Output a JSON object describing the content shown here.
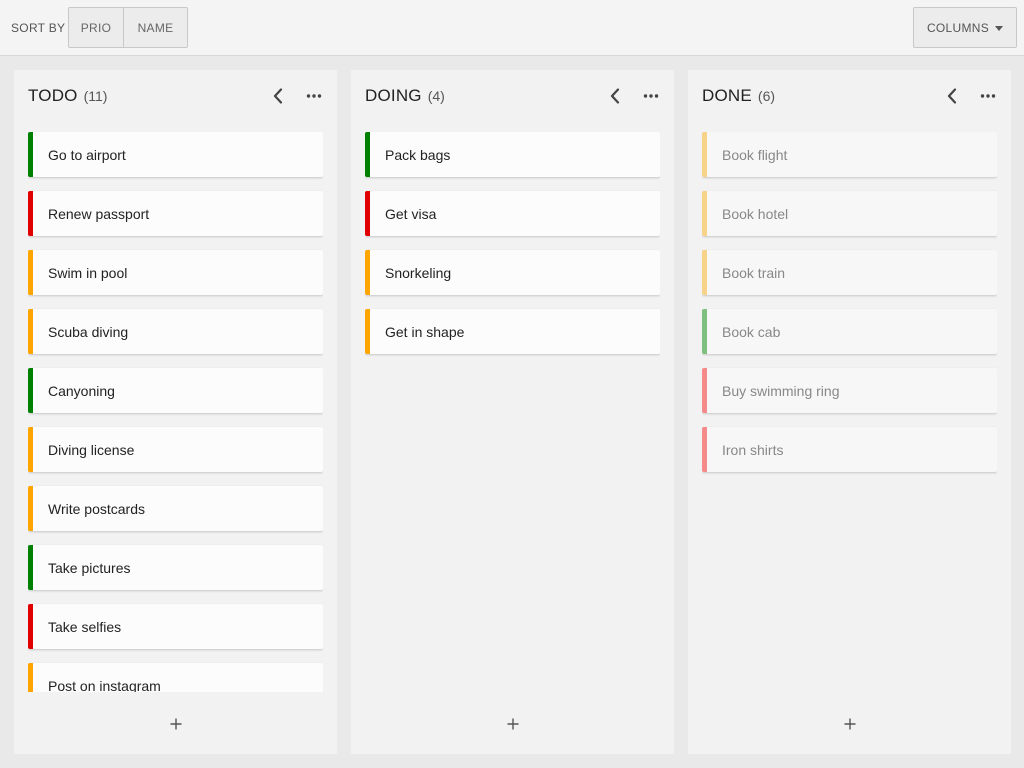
{
  "toolbar": {
    "sort_label": "SORT BY",
    "sort_prio": "PRIO",
    "sort_name": "NAME",
    "columns_label": "COLUMNS"
  },
  "colors": {
    "high": "#e00000",
    "medium": "#ffa500",
    "low": "#008000",
    "done_high": "#f48a8a",
    "done_medium": "#f7d38a",
    "done_low": "#7fbf7f"
  },
  "columns": [
    {
      "title": "TODO",
      "count": "(11)",
      "done": false,
      "cards": [
        {
          "label": "Go to airport",
          "prio": "low"
        },
        {
          "label": "Renew passport",
          "prio": "high"
        },
        {
          "label": "Swim in pool",
          "prio": "medium"
        },
        {
          "label": "Scuba diving",
          "prio": "medium"
        },
        {
          "label": "Canyoning",
          "prio": "low"
        },
        {
          "label": "Diving license",
          "prio": "medium"
        },
        {
          "label": "Write postcards",
          "prio": "medium"
        },
        {
          "label": "Take pictures",
          "prio": "low"
        },
        {
          "label": "Take selfies",
          "prio": "high"
        },
        {
          "label": "Post on instagram",
          "prio": "medium"
        }
      ]
    },
    {
      "title": "DOING",
      "count": "(4)",
      "done": false,
      "cards": [
        {
          "label": "Pack bags",
          "prio": "low"
        },
        {
          "label": "Get visa",
          "prio": "high"
        },
        {
          "label": "Snorkeling",
          "prio": "medium"
        },
        {
          "label": "Get in shape",
          "prio": "medium"
        }
      ]
    },
    {
      "title": "DONE",
      "count": "(6)",
      "done": true,
      "cards": [
        {
          "label": "Book flight",
          "prio": "medium"
        },
        {
          "label": "Book hotel",
          "prio": "medium"
        },
        {
          "label": "Book train",
          "prio": "medium"
        },
        {
          "label": "Book cab",
          "prio": "low"
        },
        {
          "label": "Buy swimming ring",
          "prio": "high"
        },
        {
          "label": "Iron shirts",
          "prio": "high"
        }
      ]
    }
  ]
}
